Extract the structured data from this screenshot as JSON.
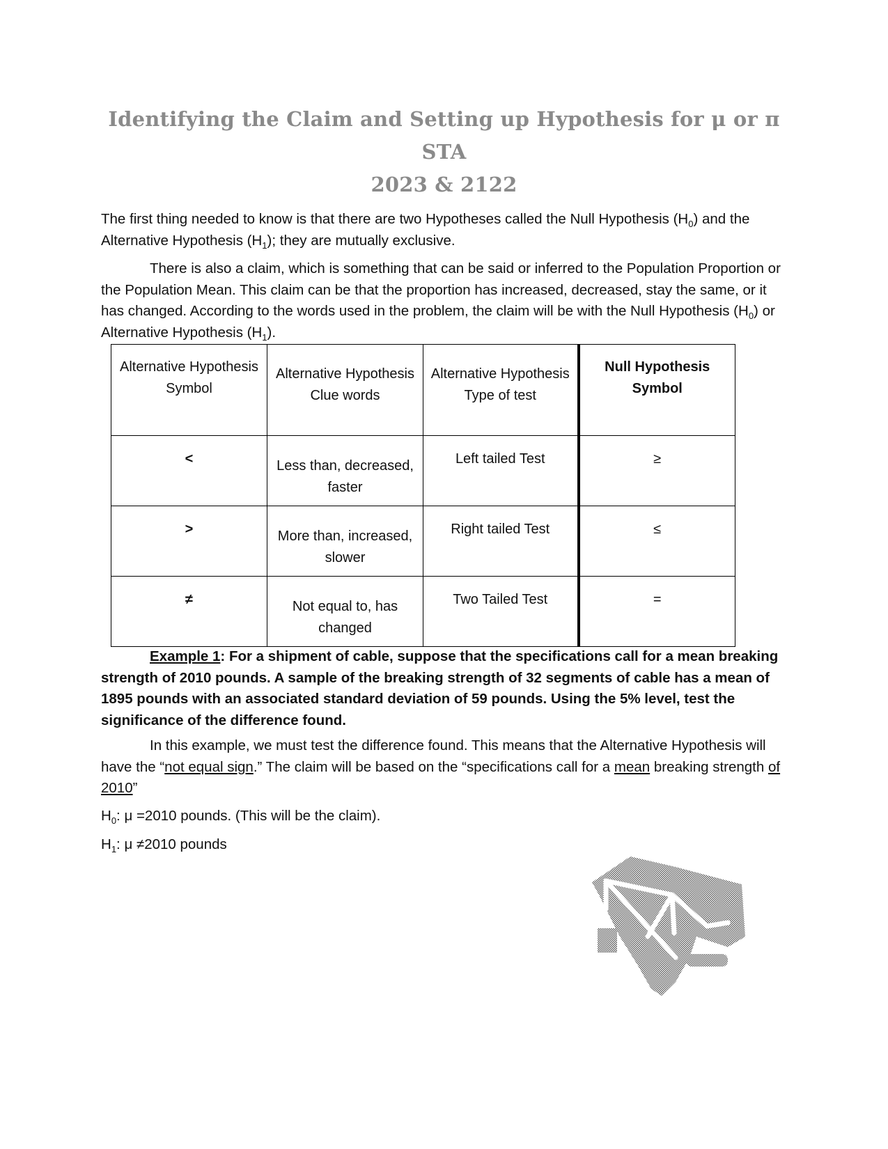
{
  "document": {
    "title_line1": "Identifying the Claim and Setting up Hypothesis for μ or π STA",
    "title_line2": "2023 & 2122",
    "para1": {
      "text_a": "The first thing needed to know is that there are two Hypotheses called the Null Hypothesis (H",
      "sub_a": "0",
      "text_b": ") and the Alternative Hypothesis (H",
      "sub_b": "1",
      "text_c": "); they are mutually exclusive."
    },
    "para2": {
      "text_a": "There is also a claim, which is something that can be said or inferred to the Population Proportion or the Population Mean. This claim can be that the proportion has increased, decreased, stay the same, or it has changed. According to the words used in the problem, the claim will be with the Null Hypothesis (H",
      "sub_a": "0",
      "text_b": ") or Alternative Hypothesis (H",
      "sub_b": "1",
      "text_c": ")."
    },
    "table": {
      "headers": [
        "Alternative Hypothesis Symbol",
        "Alternative Hypothesis Clue words",
        "Alternative Hypothesis Type of test",
        "Null Hypothesis Symbol"
      ],
      "rows": [
        {
          "alt_symbol": "<",
          "clue_words": "Less than, decreased, faster",
          "test_type": "Left tailed Test",
          "null_symbol": "≥"
        },
        {
          "alt_symbol": ">",
          "clue_words": "More than, increased, slower",
          "test_type": "Right tailed Test",
          "null_symbol": "≤"
        },
        {
          "alt_symbol": "≠",
          "clue_words": "Not equal to, has changed",
          "test_type": "Two Tailed Test",
          "null_symbol": "="
        }
      ]
    },
    "example1": {
      "label": "Example 1",
      "text": ": For a shipment of cable, suppose that the specifications call for a mean breaking strength of 2010 pounds. A sample of the breaking strength of 32 segments of cable has a mean of 1895 pounds with an associated standard deviation of 59 pounds. Using the 5% level, test the significance of the difference found."
    },
    "para4": {
      "text_a": "In this example, we must test the difference found. This means that the Alternative Hypothesis will have the “",
      "ul_a": "not equal sign",
      "text_b": ".” The claim will be based on the “specifications call for a ",
      "ul_b": "mean",
      "text_c": " breaking strength ",
      "ul_c": "of 2010",
      "text_d": "”"
    },
    "h0_line": {
      "prefix": "H",
      "sub": "0",
      "text": ": μ =2010 pounds. (This will be the claim)."
    },
    "h1_line": {
      "prefix": "H",
      "sub": "1",
      "text": ": μ ≠2010 pounds"
    },
    "logo_icon": "university-crane-logo"
  }
}
